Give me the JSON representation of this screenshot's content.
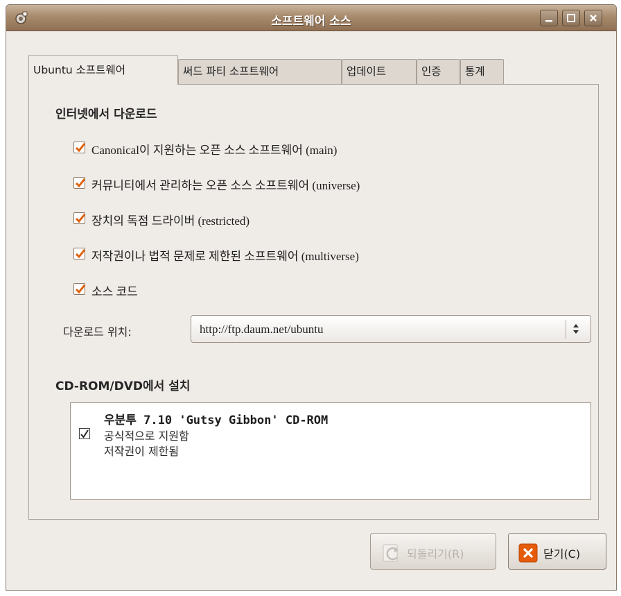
{
  "window": {
    "title": "소프트웨어 소스"
  },
  "tabs": [
    {
      "label": "Ubuntu 소프트웨어",
      "active": true
    },
    {
      "label": "써드 파티 소프트웨어",
      "active": false
    },
    {
      "label": "업데이트",
      "active": false
    },
    {
      "label": "인증",
      "active": false
    },
    {
      "label": "통계",
      "active": false
    }
  ],
  "internet": {
    "title": "인터넷에서 다운로드",
    "options": [
      {
        "label": "Canonical이 지원하는 오픈 소스 소프트웨어 (main)",
        "checked": true
      },
      {
        "label": "커뮤니티에서 관리하는 오픈 소스 소프트웨어 (universe)",
        "checked": true
      },
      {
        "label": "장치의 독점 드라이버 (restricted)",
        "checked": true
      },
      {
        "label": "저작권이나 법적 문제로 제한된 소프트웨어 (multiverse)",
        "checked": true
      },
      {
        "label": "소스 코드",
        "checked": true
      }
    ],
    "download_label": "다운로드 위치:",
    "download_value": "http://ftp.daum.net/ubuntu"
  },
  "cdrom": {
    "title": "CD-ROM/DVD에서 설치",
    "item": {
      "title": "우분투 7.10 'Gutsy Gibbon' CD-ROM",
      "line1": "공식적으로 지원함",
      "line2": "저작권이 제한됨",
      "checked": true
    }
  },
  "buttons": {
    "revert": "되돌리기(R)",
    "close": "닫기(C)"
  },
  "colors": {
    "checkbox_accent": "#e0620d",
    "titlebar": "#a88a6c",
    "close_icon": "#e55b0a"
  }
}
